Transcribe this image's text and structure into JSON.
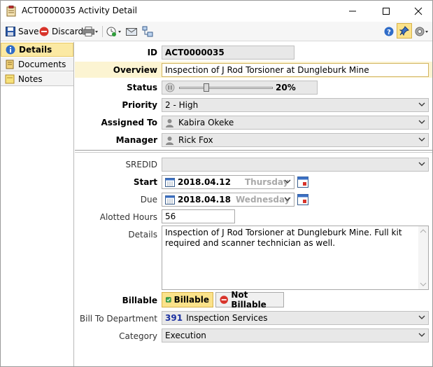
{
  "window": {
    "title": "ACT0000035 Activity Detail"
  },
  "toolbar": {
    "save_label": "Save",
    "discard_label": "Discard"
  },
  "nav": {
    "items": [
      {
        "label": "Details"
      },
      {
        "label": "Documents"
      },
      {
        "label": "Notes"
      }
    ]
  },
  "form": {
    "id_label": "ID",
    "id_value": "ACT0000035",
    "overview_label": "Overview",
    "overview_value": "Inspection of J Rod Torsioner at Dungleburk Mine",
    "status_label": "Status",
    "status_value": "20%",
    "status_fraction": 0.2,
    "priority_label": "Priority",
    "priority_value": "2 - High",
    "assigned_label": "Assigned To",
    "assigned_value": "Kabira Okeke",
    "manager_label": "Manager",
    "manager_value": "Rick Fox",
    "sredid_label": "SREDID",
    "sredid_value": "",
    "start_label": "Start",
    "start_date": "2018.04.12",
    "start_day": "Thursday",
    "due_label": "Due",
    "due_date": "2018.04.18",
    "due_day": "Wednesday",
    "hours_label": "Alotted Hours",
    "hours_value": "56",
    "details_label": "Details",
    "details_value": "Inspection of J Rod Torsioner at Dungleburk Mine. Full kit required and scanner technician as well.",
    "billable_label": "Billable",
    "billable_on": "Billable",
    "billable_off": "Not Billable",
    "bill_dept_label": "Bill To Department",
    "bill_dept_code": "391",
    "bill_dept_name": "Inspection Services",
    "category_label": "Category",
    "category_value": "Execution"
  },
  "colors": {
    "accent_yellow": "#fbe28a",
    "overview_highlight": "#fcf4d2",
    "dept_code_blue": "#1a2fa0"
  }
}
